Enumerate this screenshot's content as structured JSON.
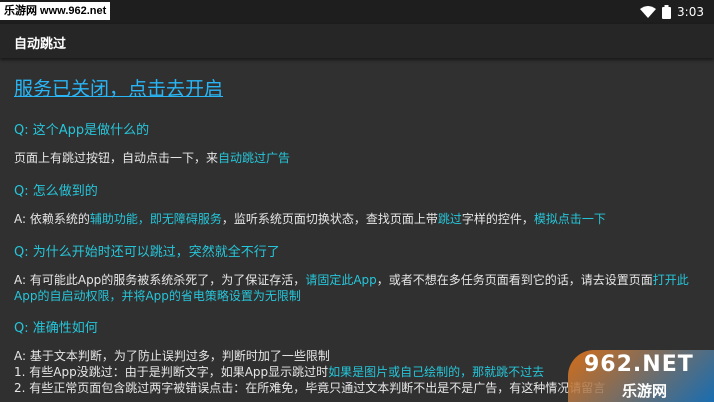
{
  "status_bar": {
    "site_tag": "乐游网 www.962.net",
    "time": "3:03"
  },
  "app_bar": {
    "title": "自动跳过"
  },
  "service_link": "服务已关闭，点击去开启",
  "faq": [
    {
      "q": "Q: 这个App是做什么的",
      "a_parts": [
        "页面上有跳过按钮，自动点击一下，来",
        "自动跳过广告"
      ]
    },
    {
      "q": "Q: 怎么做到的",
      "a_parts": [
        "A: 依赖系统的",
        "辅助功能，即无障碍服务",
        "，监听系统页面切换状态，查找页面上带",
        "跳过",
        "字样的控件，",
        "模拟点击一下"
      ]
    },
    {
      "q": "Q: 为什么开始时还可以跳过，突然就全不行了",
      "a_parts": [
        "A: 有可能此App的服务被系统杀死了，为了保证存活，",
        "请固定此App",
        "，或者不想在多任务页面看到它的话，请去设置页面",
        "打开此App的自启动权限，并将App的省电策略设置为无限制"
      ]
    },
    {
      "q": "Q: 准确性如何",
      "a_parts": [
        "A: 基于文本判断，为了防止误判过多，判断时加了一些限制",
        " 1. 有些App没跳过：由于是判断文字，如果App显示跳过时",
        "如果是图片或自己绘制的，那就跳不过去",
        " 2. 有些正常页面包含跳过两字被错误点击：在所难免，毕竟只通过文本判断不出是不是广告，有这种情况请留言"
      ]
    }
  ],
  "watermark": {
    "brand": "962.NET",
    "sub": "乐游网"
  }
}
